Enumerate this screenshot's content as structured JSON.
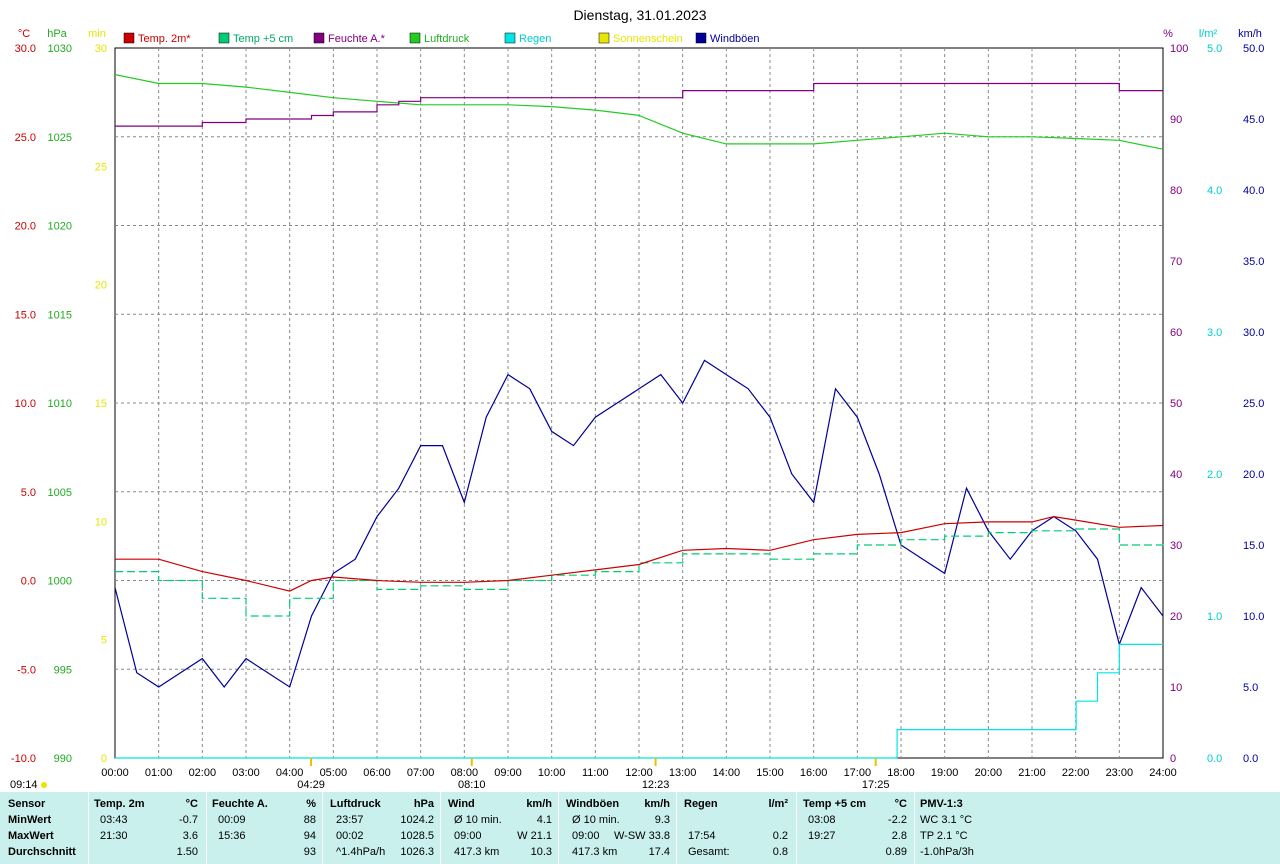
{
  "title": "Dienstag, 31.01.2023",
  "axes": {
    "temp_unit": "°C",
    "pressure_unit": "hPa",
    "sun_unit": "min",
    "humidity_unit": "%",
    "rain_unit": "l/m²",
    "wind_unit": "km/h",
    "temp_ticks": [
      "30.0",
      "25.0",
      "20.0",
      "15.0",
      "10.0",
      "5.0",
      "0.0",
      "-5.0",
      "-10.0"
    ],
    "pressure_ticks": [
      "1030",
      "1025",
      "1020",
      "1015",
      "1010",
      "1005",
      "1000",
      "995",
      "990"
    ],
    "sun_ticks": [
      "30",
      "25",
      "20",
      "15",
      "10",
      "5",
      "0"
    ],
    "humidity_ticks": [
      "100",
      "90",
      "80",
      "70",
      "60",
      "50",
      "40",
      "30",
      "20",
      "10",
      "0"
    ],
    "rain_ticks": [
      "5.0",
      "4.0",
      "3.0",
      "2.0",
      "1.0",
      "0.0"
    ],
    "wind_ticks": [
      "50.0",
      "45.0",
      "40.0",
      "35.0",
      "30.0",
      "25.0",
      "20.0",
      "15.0",
      "10.0",
      "5.0",
      "0.0"
    ],
    "x_ticks": [
      "00:00",
      "01:00",
      "02:00",
      "03:00",
      "04:00",
      "05:00",
      "06:00",
      "07:00",
      "08:00",
      "09:00",
      "10:00",
      "11:00",
      "12:00",
      "13:00",
      "14:00",
      "15:00",
      "16:00",
      "17:00",
      "18:00",
      "19:00",
      "20:00",
      "21:00",
      "22:00",
      "23:00",
      "24:00"
    ]
  },
  "markers": {
    "sunrise": "09:14",
    "m1": "04:29",
    "m2": "08:10",
    "m3": "12:23",
    "m4": "17:25"
  },
  "colors": {
    "temp2m": "#cc0000",
    "temp5cm": "#00cc77",
    "humidity": "#800080",
    "pressure": "#22cc22",
    "rain": "#00e5e5",
    "sunshine": "#e6e600",
    "gusts": "#000099"
  },
  "chart_data": {
    "type": "line",
    "x_unit": "hour of day",
    "xlim": [
      0,
      24
    ],
    "series": [
      {
        "name": "Temp. 2m*",
        "axis": "°C",
        "x": [
          0,
          1,
          2,
          3,
          4,
          4.5,
          5,
          6,
          7,
          8,
          9,
          10,
          11,
          12,
          13,
          14,
          15,
          16,
          17,
          18,
          19,
          20,
          21,
          21.5,
          22,
          23,
          24
        ],
        "values": [
          1.2,
          1.2,
          0.5,
          0.0,
          -0.6,
          0.0,
          0.2,
          0.0,
          -0.1,
          -0.1,
          0.0,
          0.3,
          0.6,
          0.9,
          1.7,
          1.8,
          1.7,
          2.3,
          2.6,
          2.7,
          3.2,
          3.3,
          3.3,
          3.6,
          3.4,
          3.0,
          3.1
        ]
      },
      {
        "name": "Temp +5 cm",
        "axis": "°C",
        "x": [
          0,
          1,
          2,
          3,
          4,
          5,
          6,
          7,
          8,
          9,
          10,
          11,
          12,
          13,
          14,
          15,
          16,
          17,
          18,
          19,
          20,
          21,
          22,
          23,
          24
        ],
        "values": [
          0.5,
          0.0,
          -1.0,
          -2.0,
          -1.0,
          0.0,
          -0.5,
          -0.3,
          -0.5,
          0.0,
          0.3,
          0.5,
          1.0,
          1.5,
          1.5,
          1.2,
          1.5,
          2.0,
          2.3,
          2.5,
          2.7,
          2.8,
          2.9,
          2.0,
          2.2
        ]
      },
      {
        "name": "Feuchte A.*",
        "axis": "%",
        "x": [
          0,
          0.5,
          2,
          3,
          4,
          4.5,
          5,
          6,
          6.5,
          7,
          8,
          9,
          10,
          11,
          12,
          12.5,
          13,
          14,
          15,
          16,
          17,
          18,
          19,
          20,
          21,
          22,
          23,
          24
        ],
        "values": [
          89,
          89,
          89.5,
          90,
          90,
          90.5,
          91,
          92,
          92.5,
          93,
          93,
          93,
          93,
          93,
          93,
          93,
          94,
          94,
          94,
          95,
          95,
          95,
          95,
          95,
          95,
          95,
          94,
          94
        ]
      },
      {
        "name": "Luftdruck",
        "axis": "hPa",
        "x": [
          0,
          1,
          2,
          3,
          4,
          5,
          6,
          7,
          8,
          9,
          10,
          11,
          12,
          13,
          14,
          15,
          16,
          17,
          18,
          19,
          20,
          21,
          22,
          23,
          24
        ],
        "values": [
          1028.5,
          1028.0,
          1028.0,
          1027.8,
          1027.5,
          1027.2,
          1027.0,
          1026.8,
          1026.8,
          1026.8,
          1026.7,
          1026.5,
          1026.2,
          1025.2,
          1024.6,
          1024.6,
          1024.6,
          1024.8,
          1025.0,
          1025.2,
          1025.0,
          1025.0,
          1024.9,
          1024.8,
          1024.3
        ]
      },
      {
        "name": "Regen",
        "axis": "l/m²",
        "x": [
          0,
          17.9,
          17.91,
          22.0,
          22.01,
          22.5,
          23.0,
          23.0,
          24
        ],
        "values": [
          0,
          0,
          0.2,
          0.2,
          0.4,
          0.6,
          0.8,
          0.8,
          0.8
        ]
      },
      {
        "name": "Sonnenschein",
        "axis": "min",
        "x": [
          0,
          24
        ],
        "values": [
          0,
          0
        ]
      },
      {
        "name": "Windböen",
        "axis": "km/h",
        "x": [
          0,
          0.5,
          1,
          1.5,
          2,
          2.5,
          3,
          3.5,
          4,
          4.5,
          5,
          5.5,
          6,
          6.5,
          7,
          7.5,
          8,
          8.5,
          9,
          9.5,
          10,
          10.5,
          11,
          11.5,
          12,
          12.5,
          13,
          13.5,
          14,
          14.5,
          15,
          15.5,
          16,
          16.5,
          17,
          17.5,
          18,
          18.5,
          19,
          19.5,
          20,
          20.5,
          21,
          21.5,
          22,
          22.5,
          23,
          23.5,
          24
        ],
        "values": [
          12,
          6,
          5,
          6,
          7,
          5,
          7,
          6,
          5,
          10,
          13,
          14,
          17,
          19,
          22,
          22,
          18,
          24,
          27,
          26,
          23,
          22,
          24,
          25,
          26,
          27,
          25,
          28,
          27,
          26,
          24,
          20,
          18,
          26,
          24,
          20,
          15,
          14,
          13,
          19,
          16,
          14,
          16,
          17,
          16,
          14,
          8,
          12,
          10
        ]
      }
    ]
  },
  "stats": {
    "headers": {
      "sensor": "Sensor",
      "temp": "Temp. 2m",
      "temp_u": "°C",
      "hum": "Feuchte A.",
      "hum_u": "%",
      "press": "Luftdruck",
      "press_u": "hPa",
      "wind": "Wind",
      "wind_u": "km/h",
      "gust": "Windböen",
      "gust_u": "km/h",
      "rain": "Regen",
      "rain_u": "l/m²",
      "t5": "Temp +5 cm",
      "t5_u": "°C",
      "pmv": "PMV-1:3"
    },
    "row_labels": {
      "min": "MinWert",
      "max": "MaxWert",
      "avg": "Durchschnitt"
    },
    "min": {
      "temp_t": "03:43",
      "temp_v": "-0.7",
      "hum_t": "00:09",
      "hum_v": "88",
      "press_t": "23:57",
      "press_v": "1024.2",
      "wind_t": "Ø 10 min.",
      "wind_v": "4.1",
      "gust_t": "Ø 10 min.",
      "gust_v": "9.3",
      "rain_t": "",
      "rain_v": "",
      "t5_t": "03:08",
      "t5_v": "-2.2",
      "pmv": "WC 3.1 °C"
    },
    "max": {
      "temp_t": "21:30",
      "temp_v": "3.6",
      "hum_t": "15:36",
      "hum_v": "94",
      "press_t": "00:02",
      "press_v": "1028.5",
      "wind_t": "09:00",
      "wind_v": "W 21.1",
      "gust_t": "09:00",
      "gust_v": "W-SW 33.8",
      "rain_t": "17:54",
      "rain_v": "0.2",
      "t5_t": "19:27",
      "t5_v": "2.8",
      "pmv": "TP 2.1 °C"
    },
    "avg": {
      "temp_v": "1.50",
      "hum_v": "93",
      "press_t": "^1.4hPa/h",
      "press_v": "1026.3",
      "wind_t": "417.3 km",
      "wind_v": "10.3",
      "gust_t": "417.3 km",
      "gust_v": "17.4",
      "rain_t": "Gesamt:",
      "rain_v": "0.8",
      "t5_v": "0.89",
      "pmv": "-1.0hPa/3h"
    }
  }
}
